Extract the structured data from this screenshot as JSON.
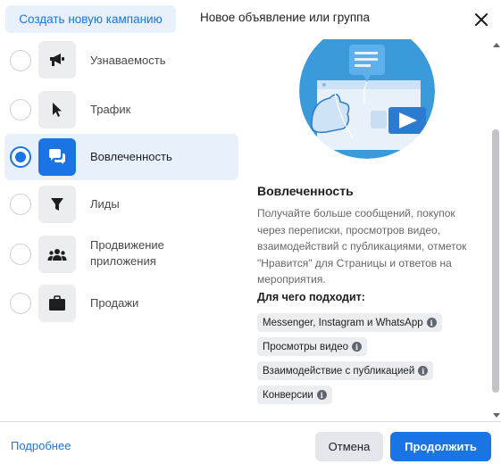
{
  "header": {
    "tab_create_campaign": "Создать новую кампанию",
    "tab_new_ad_or_group": "Новое объявление или группа"
  },
  "objectives": [
    {
      "label": "Узнаваемость",
      "icon": "megaphone-icon",
      "selected": false
    },
    {
      "label": "Трафик",
      "icon": "cursor-icon",
      "selected": false
    },
    {
      "label": "Вовлеченность",
      "icon": "chat-bubbles-icon",
      "selected": true
    },
    {
      "label": "Лиды",
      "icon": "funnel-icon",
      "selected": false
    },
    {
      "label": "Продвижение приложения",
      "icon": "people-icon",
      "selected": false
    },
    {
      "label": "Продажи",
      "icon": "briefcase-icon",
      "selected": false
    }
  ],
  "detail": {
    "title": "Вовлеченность",
    "description": "Получайте больше сообщений, покупок через переписки, просмотров видео, взаимодействий с публикациями, отметок \"Нравится\" для Страницы и ответов на мероприятия.",
    "fit_title": "Для чего подходит:",
    "chips": [
      "Messenger, Instagram и WhatsApp",
      "Просмотры видео",
      "Взаимодействие с публикацией",
      "Конверсии"
    ]
  },
  "footer": {
    "learn_more": "Подробнее",
    "cancel": "Отмена",
    "continue": "Продолжить"
  },
  "colors": {
    "accent": "#1b74e4",
    "selected_bg": "#e7f0fb",
    "illustration_bg": "#3b9ad9"
  }
}
